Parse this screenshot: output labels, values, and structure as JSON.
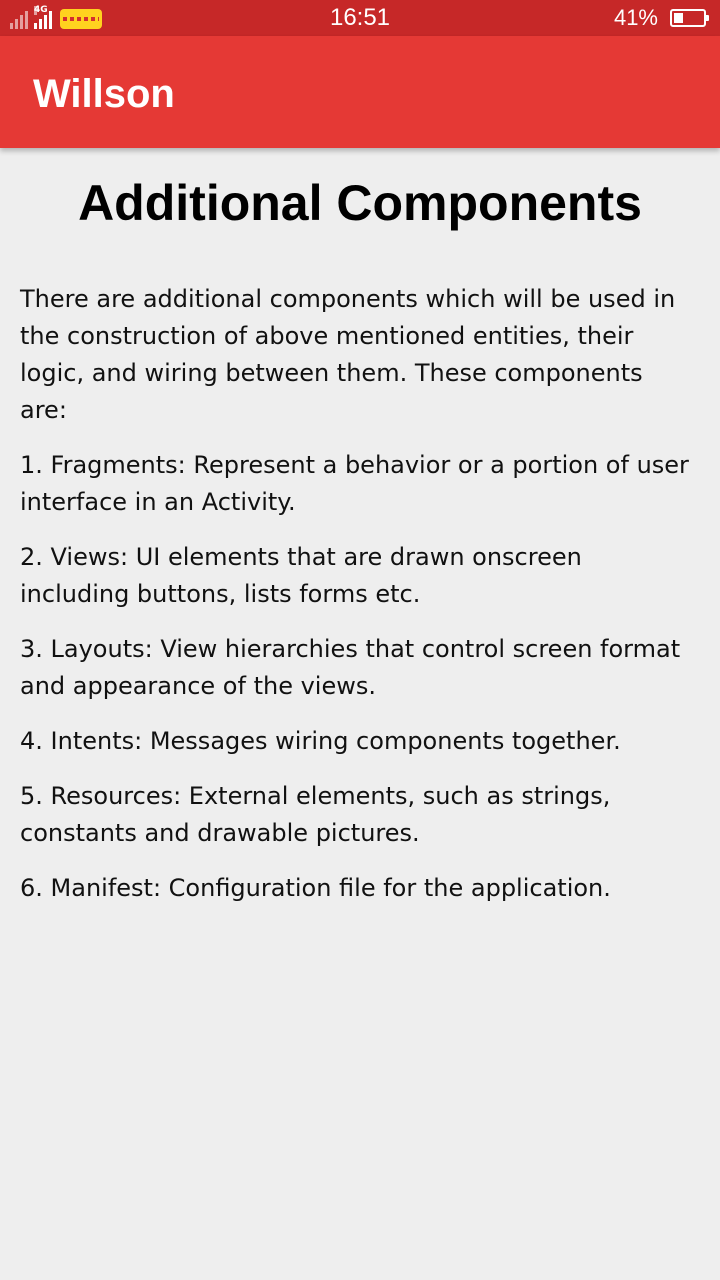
{
  "status_bar": {
    "network_type": "4G",
    "time": "16:51",
    "battery_percent": "41%",
    "battery_level": 0.41,
    "icons": [
      "signal-icon",
      "signal-4g-icon",
      "carrier-logo-icon",
      "battery-icon"
    ]
  },
  "app_bar": {
    "title": "Willson",
    "color": "#e53935"
  },
  "content": {
    "heading": "Additional Components",
    "paragraphs": [
      "There are additional components which will be used in the construction of above mentioned entities, their logic, and wiring between them. These components are:",
      "1. Fragments: Represent a behavior or a portion of user interface in an Activity.",
      "2. Views: UI elements that are drawn onscreen including buttons, lists forms etc.",
      "3. Layouts: View hierarchies that control screen format and appearance of the views.",
      "4. Intents: Messages wiring components together.",
      "5. Resources: External elements, such as strings, constants and drawable pictures.",
      "6. Manifest: Configuration file for the application."
    ]
  },
  "colors": {
    "status_bar": "#c62828",
    "app_bar": "#e53935",
    "background": "#eeeeee"
  }
}
